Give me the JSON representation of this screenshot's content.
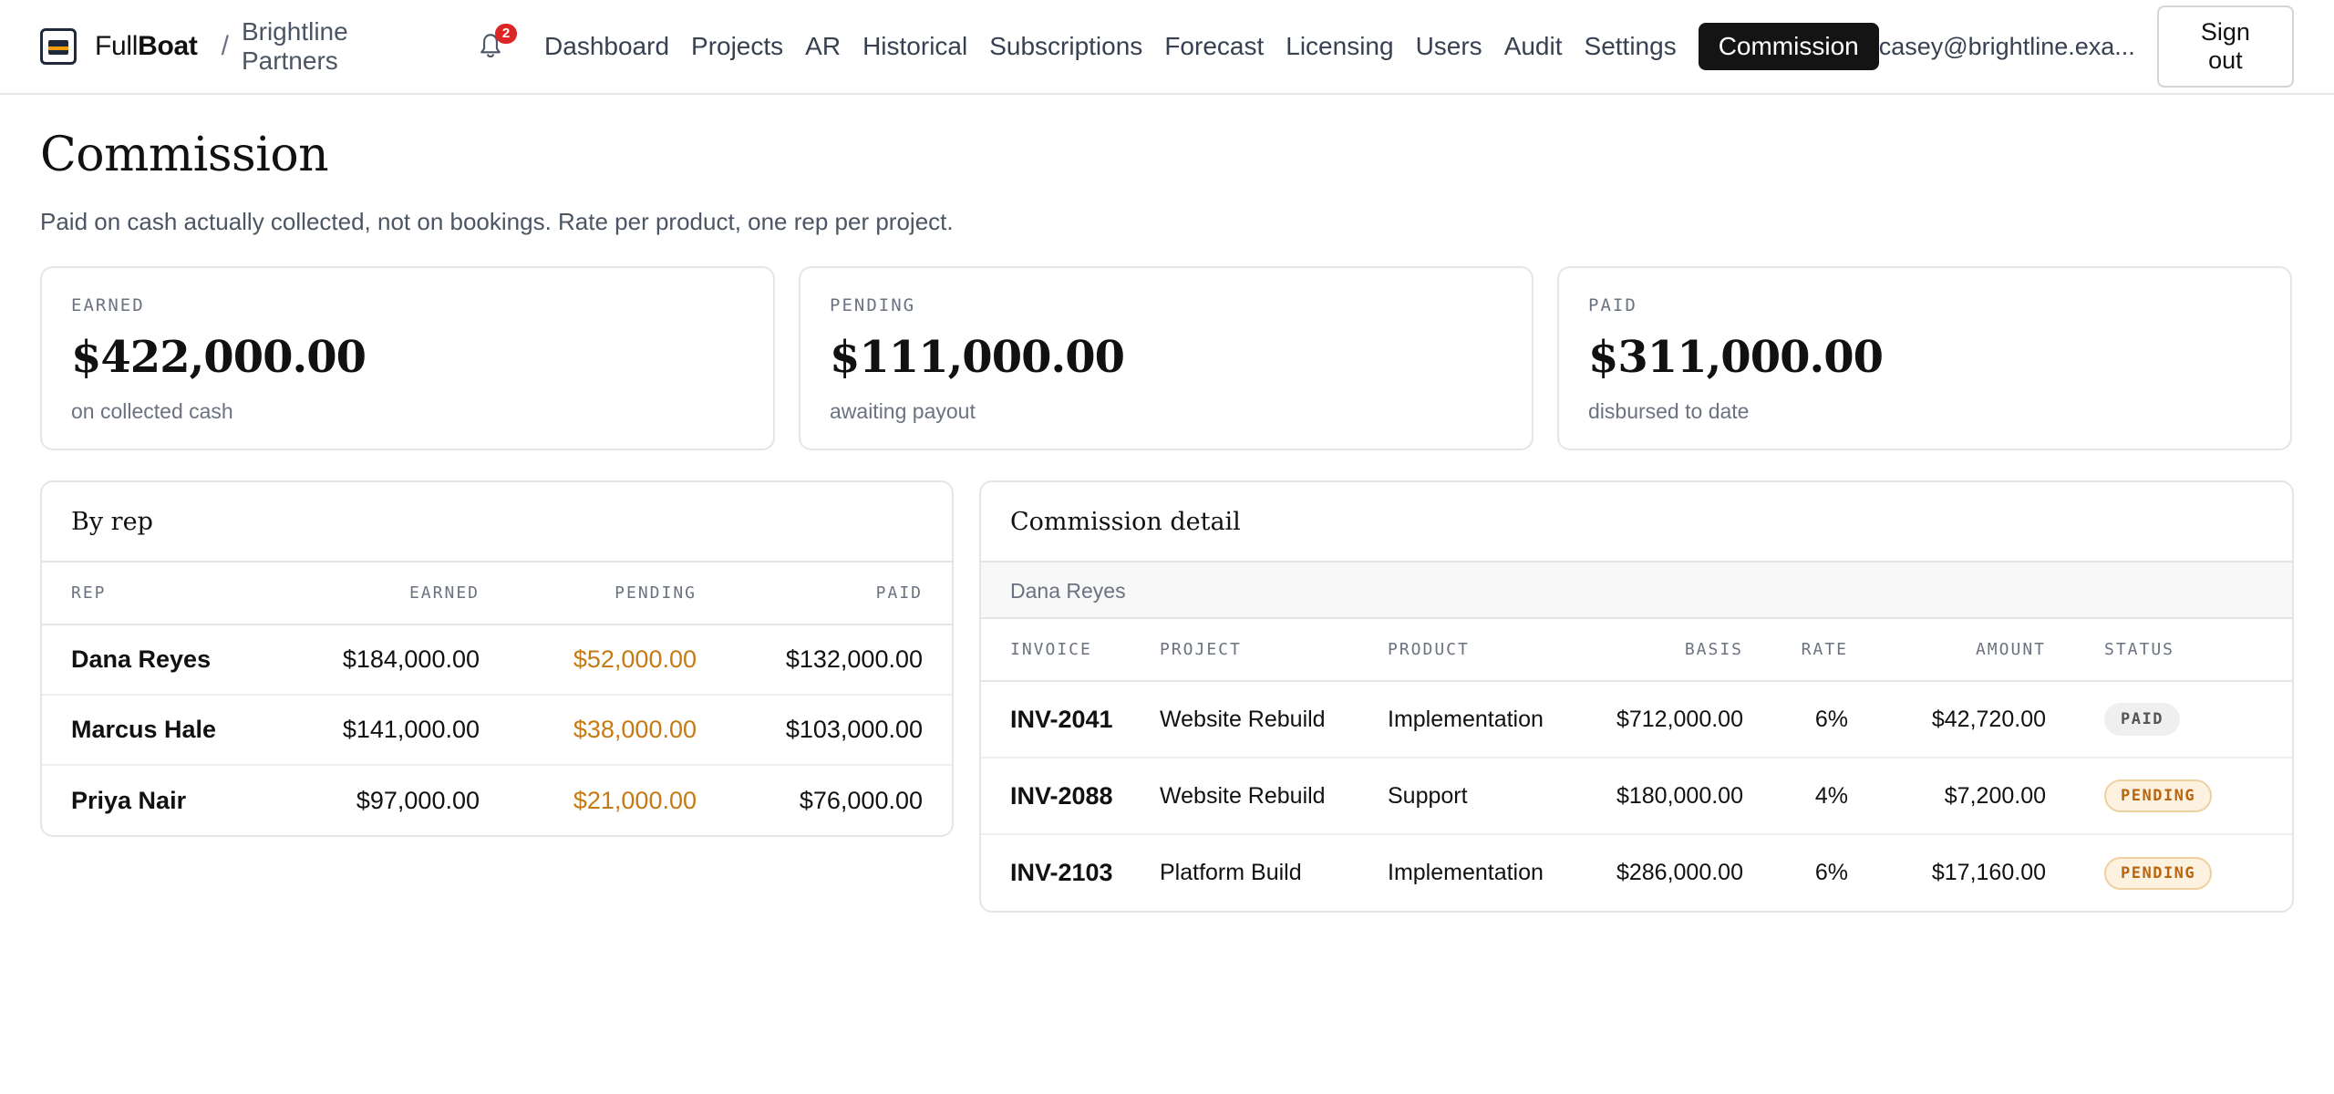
{
  "app": {
    "brand_light": "Full",
    "brand_bold": "Boat",
    "separator": "/",
    "org": "Brightline Partners",
    "notifications_count": "2",
    "nav": [
      {
        "label": "Dashboard"
      },
      {
        "label": "Projects"
      },
      {
        "label": "AR"
      },
      {
        "label": "Historical"
      },
      {
        "label": "Subscriptions"
      },
      {
        "label": "Forecast"
      },
      {
        "label": "Licensing"
      },
      {
        "label": "Users"
      },
      {
        "label": "Audit"
      },
      {
        "label": "Settings"
      },
      {
        "label": "Commission",
        "active": true
      }
    ],
    "user_email": "casey@brightline.exa...",
    "sign_out": "Sign out"
  },
  "page": {
    "title": "Commission",
    "subtitle": "Paid on cash actually collected, not on bookings. Rate per product, one rep per project."
  },
  "stats": [
    {
      "label": "EARNED",
      "value": "$422,000.00",
      "note": "on collected cash"
    },
    {
      "label": "PENDING",
      "value": "$111,000.00",
      "note": "awaiting payout"
    },
    {
      "label": "PAID",
      "value": "$311,000.00",
      "note": "disbursed to date"
    }
  ],
  "by_rep": {
    "title": "By rep",
    "columns": [
      "REP",
      "EARNED",
      "PENDING",
      "PAID"
    ],
    "rows": [
      {
        "rep": "Dana Reyes",
        "earned": "$184,000.00",
        "pending": "$52,000.00",
        "paid": "$132,000.00"
      },
      {
        "rep": "Marcus Hale",
        "earned": "$141,000.00",
        "pending": "$38,000.00",
        "paid": "$103,000.00"
      },
      {
        "rep": "Priya Nair",
        "earned": "$97,000.00",
        "pending": "$21,000.00",
        "paid": "$76,000.00"
      }
    ]
  },
  "detail": {
    "title": "Commission detail",
    "group": "Dana Reyes",
    "columns": [
      "INVOICE",
      "PROJECT",
      "PRODUCT",
      "BASIS",
      "RATE",
      "AMOUNT",
      "STATUS"
    ],
    "rows": [
      {
        "invoice": "INV-2041",
        "project": "Website Rebuild",
        "product": "Implementation",
        "basis": "$712,000.00",
        "rate": "6%",
        "amount": "$42,720.00",
        "status": "PAID"
      },
      {
        "invoice": "INV-2088",
        "project": "Website Rebuild",
        "product": "Support",
        "basis": "$180,000.00",
        "rate": "4%",
        "amount": "$7,200.00",
        "status": "PENDING"
      },
      {
        "invoice": "INV-2103",
        "project": "Platform Build",
        "product": "Implementation",
        "basis": "$286,000.00",
        "rate": "6%",
        "amount": "$17,160.00",
        "status": "PENDING"
      }
    ]
  },
  "colors": {
    "pending_amount": "#c57a14",
    "nav_active_bg": "#141414",
    "badge_red": "#dc2626"
  }
}
